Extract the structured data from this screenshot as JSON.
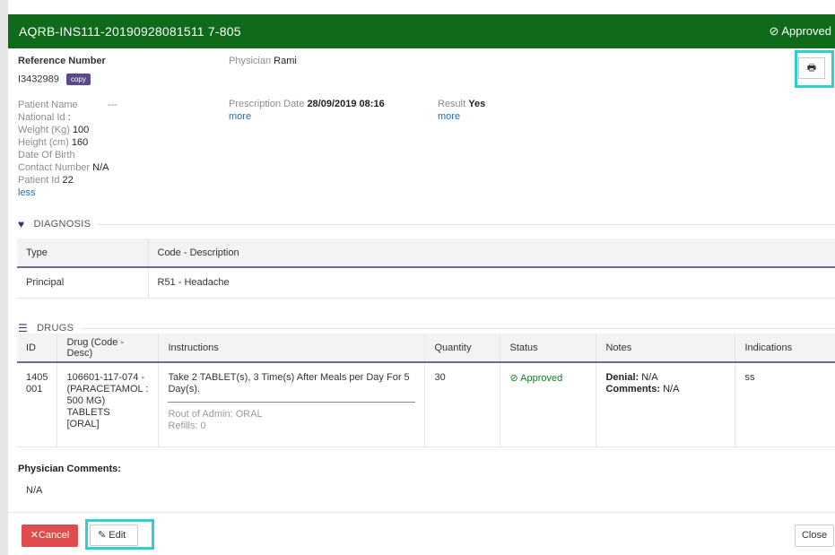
{
  "header": {
    "title": "AQRB-INS111-20190928081511 7-805",
    "status_icon": "check-circle-icon",
    "status": "Approved",
    "background": "#0f6b1a"
  },
  "reference": {
    "label": "Reference Number",
    "value": "I3432989",
    "copy_label": "copy"
  },
  "physician": {
    "label": "Physician",
    "value": "Rami"
  },
  "prescription": {
    "label": "Prescription Date",
    "value": "28/09/2019 08:16",
    "more": "more"
  },
  "result": {
    "label": "Result",
    "value": "Yes",
    "more": "more"
  },
  "patient": {
    "name_label": "Patient Name",
    "name_value": "---",
    "national_id_label": "National Id",
    "national_id_value": ":",
    "weight_label": "Weight (Kg)",
    "weight_value": "100",
    "height_label": "Height (cm)",
    "height_value": "160",
    "dob_label": "Date Of Birth",
    "dob_value": "",
    "contact_label": "Contact Number",
    "contact_value": "N/A",
    "patient_id_label": "Patient Id",
    "patient_id_value": "22",
    "less": "less"
  },
  "diagnosis": {
    "title": "DIAGNOSIS",
    "icon": "heart-icon",
    "columns": [
      "Type",
      "Code - Description"
    ],
    "rows": [
      [
        "Principal",
        "R51 - Headache"
      ]
    ]
  },
  "drugs": {
    "title": "DRUGS",
    "icon": "list-icon",
    "columns": [
      "ID",
      "Drug (Code - Desc)",
      "Instructions",
      "Quantity",
      "Status",
      "Notes",
      "Indications"
    ],
    "row": {
      "id_line1": "1405",
      "id_line2": "001",
      "drug_line1": "106601-117-074 -",
      "drug_line2": "(PARACETAMOL :",
      "drug_line3": "500 MG) TABLETS",
      "drug_line4": "[ORAL]",
      "instructions_line1": "Take 2 TABLET(s), 3 Time(s) After Meals per Day For 5",
      "instructions_line2": "Day(s).",
      "route": "Rout of Admin: ORAL",
      "refills": "Refills: 0",
      "quantity": "30",
      "status": "Approved",
      "status_icon": "check-circle-icon",
      "denial_label": "Denial:",
      "denial_value": "N/A",
      "comments_label": "Comments:",
      "comments_value": "N/A",
      "indications": "ss"
    }
  },
  "physician_comments": {
    "label": "Physician Comments:",
    "value": "N/A"
  },
  "footer": {
    "cancel_label": "Cancel",
    "edit_label": "Edit",
    "close_label": "Close"
  },
  "colors": {
    "accent_highlight": "#2ad1d1",
    "cancel": "#e04b4b",
    "copy_badge": "#5b4a87",
    "approved_text": "#1a7a2a"
  }
}
